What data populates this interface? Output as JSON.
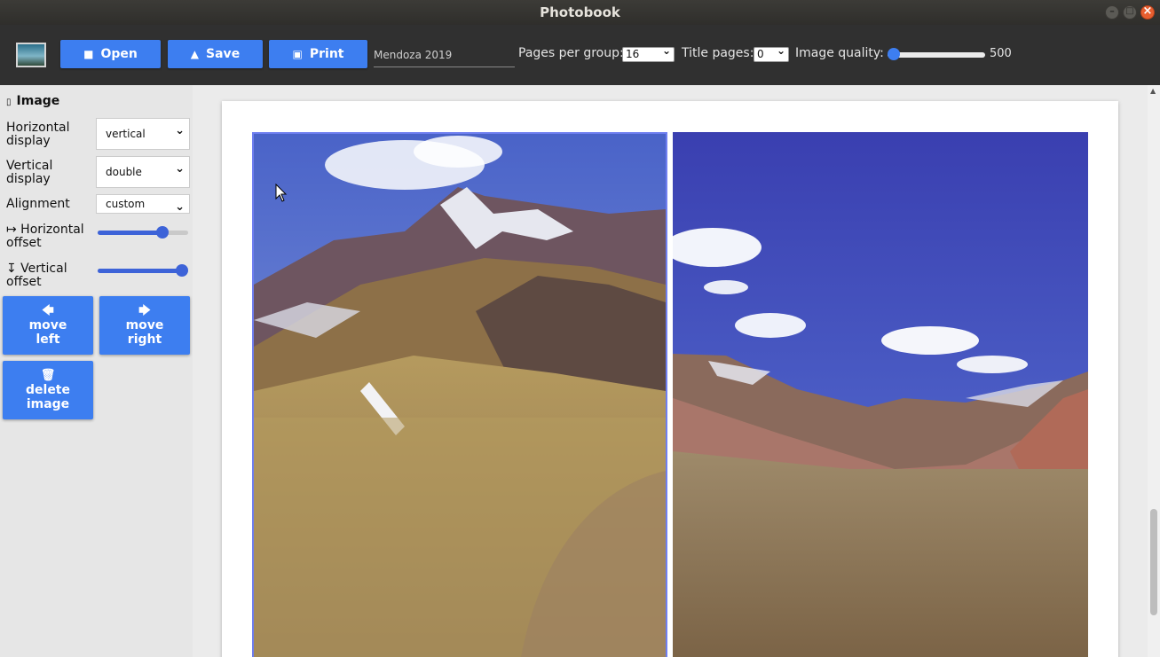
{
  "window": {
    "title": "Photobook"
  },
  "toolbar": {
    "open_label": "Open",
    "save_label": "Save",
    "print_label": "Print",
    "project_name": "Mendoza 2019",
    "pages_per_group_label": "Pages per group:",
    "pages_per_group_value": "16",
    "title_pages_label": "Title pages:",
    "title_pages_value": "0",
    "image_quality_label": "Image quality:",
    "image_quality_value": "500",
    "image_quality_fraction": 0.0
  },
  "panel": {
    "heading": "Image",
    "horizontal_display_label": "Horizontal display",
    "horizontal_display_value": "vertical",
    "vertical_display_label": "Vertical display",
    "vertical_display_value": "double",
    "alignment_label": "Alignment",
    "alignment_value": "custom",
    "horizontal_offset_label": "↦ Horizontal offset",
    "horizontal_offset_fraction": 0.75,
    "vertical_offset_label": "↧ Vertical offset",
    "vertical_offset_fraction": 1.0,
    "move_left_label": "move left",
    "move_right_label": "move right",
    "delete_image_label": "delete image"
  },
  "colors": {
    "accent": "#3d7ef0",
    "toolbar_bg": "#303030",
    "titlebar_bg": "#3c3b37",
    "selection_border": "#6f7ff0"
  },
  "icons": [
    "folder-icon",
    "upload-icon",
    "printer-icon",
    "document-icon",
    "arrow-left-icon",
    "arrow-right-icon",
    "trash-icon"
  ]
}
